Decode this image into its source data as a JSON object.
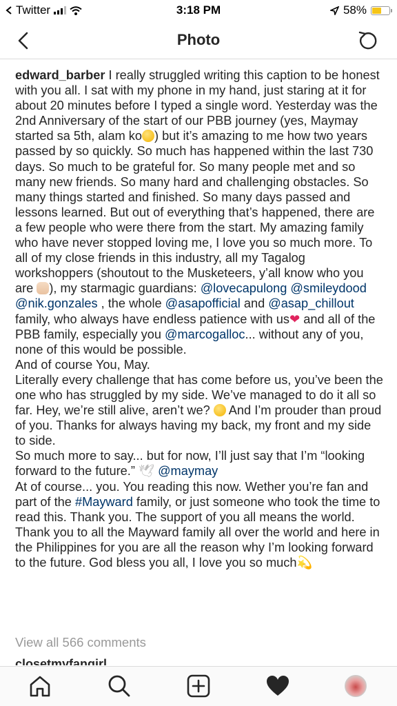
{
  "status_bar": {
    "carrier": "Twitter",
    "time": "3:18 PM",
    "battery_percent": "58%",
    "battery_level": 0.58
  },
  "header": {
    "title": "Photo",
    "back_icon": "chevron-left-icon",
    "refresh_icon": "refresh-icon"
  },
  "caption": {
    "username": "edward_barber",
    "p1": {
      "t1": " I really struggled writing this caption to be honest with you all. I sat with my phone in my hand, just staring at it for about 20 minutes before I typed a single word. Yesterday was the 2nd Anniversary of the start of our PBB journey (yes, Maymay started sa 5th, alam ko",
      "t2": ") but it’s amazing to me how two years passed by so quickly. So much has happened within the last 730 days. So much to be grateful for. So many people met and so many new friends. So many hard and challenging obstacles. So many things started and finished. So many days passed and lessons learned. But out of everything that’s happened, there are a few people who were there from the start. My amazing family who have never stopped loving me, I love you so much more. To all of my close friends in this industry, all my Tagalog workshoppers (shoutout to the Musketeers, y’all know who you are ",
      "t3": "), my starmagic guardians: ",
      "m1": "@lovecapulong",
      "m2": "@smileydood",
      "m3": "@nik.gonzales",
      "t4": " , the whole ",
      "m4": "@asapofficial",
      "t5": "  and ",
      "m5": "@asap_chillout",
      "t6": "  family, who always have endless patience with us",
      "t7": " and all of the PBB family, especially you ",
      "m6": "@marcogalloc",
      "t8": "... without any of you, none of this would be possible."
    },
    "p2": "And of course You, May.",
    "p3": {
      "t1": "Literally every challenge that has come before us, you’ve been the one who has struggled by my side. We’ve managed to do it all so far. Hey, we’re still alive, aren’t we? ",
      "t2": " And I’m prouder than proud of you. Thanks for always having my back, my front and my side to side."
    },
    "p4": {
      "t1": "So much more to say... but for now, I’ll just say that I’m “looking forward to the future.” ",
      "m1": "@maymay"
    },
    "p5": {
      "t1": "At of course... you. You reading this now. Wether you’re fan and part of the ",
      "h1": "#Mayward",
      "t2": " family, or just someone who took the time to read this. Thank you. The support of you all means the world. Thank you to all the Mayward family all over the world and here in the Philippines for you are all the reason why I’m looking forward to the future. God bless you all, I love you so much"
    },
    "emoji_icons": [
      "winking-face-icon",
      "waving-hand-icon",
      "red-heart-icon",
      "thinking-face-icon",
      "dove-icon",
      "dizzy-icon"
    ]
  },
  "comments": {
    "view_all": "View all 566 comments",
    "next_comment_user": "closetmyfangirl"
  },
  "tab_bar": {
    "icons": [
      "home-icon",
      "search-icon",
      "new-post-icon",
      "activity-heart-icon",
      "profile-avatar"
    ]
  },
  "colors": {
    "text": "#262626",
    "mention": "#003569",
    "muted": "#999999",
    "border": "#dbdbdb",
    "battery": "#f5c518"
  }
}
